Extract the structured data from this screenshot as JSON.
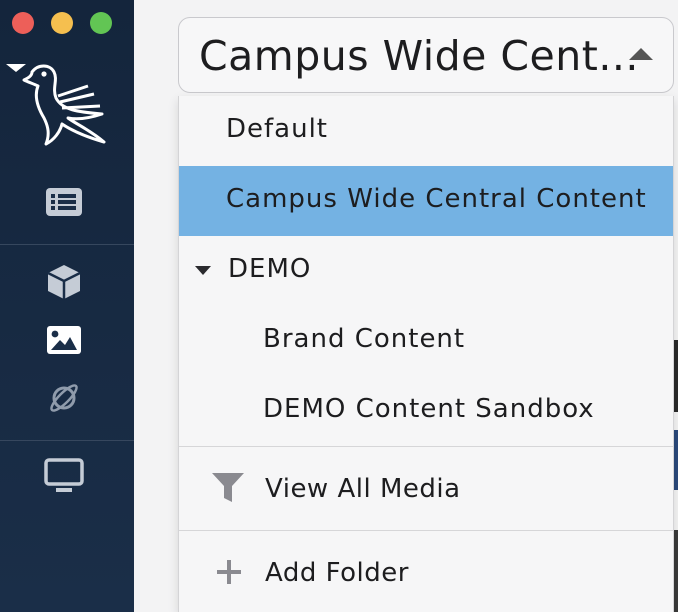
{
  "select": {
    "value": "Campus Wide Cent..."
  },
  "dropdown": {
    "items": [
      {
        "label": "Default"
      },
      {
        "label": "Campus Wide Central Content"
      },
      {
        "label": "DEMO"
      },
      {
        "label": "Brand Content"
      },
      {
        "label": "DEMO Content Sandbox"
      }
    ],
    "actions": [
      {
        "label": "View All Media",
        "icon": "filter-icon"
      },
      {
        "label": "Add Folder",
        "icon": "plus-icon"
      }
    ]
  },
  "sidebar": {
    "icons": [
      "logo-bird-icon",
      "list-icon",
      "cube-icon",
      "image-icon",
      "planet-icon",
      "monitor-icon"
    ]
  },
  "colors": {
    "selected": "#74b2e3",
    "sidebar": "#14253c"
  }
}
